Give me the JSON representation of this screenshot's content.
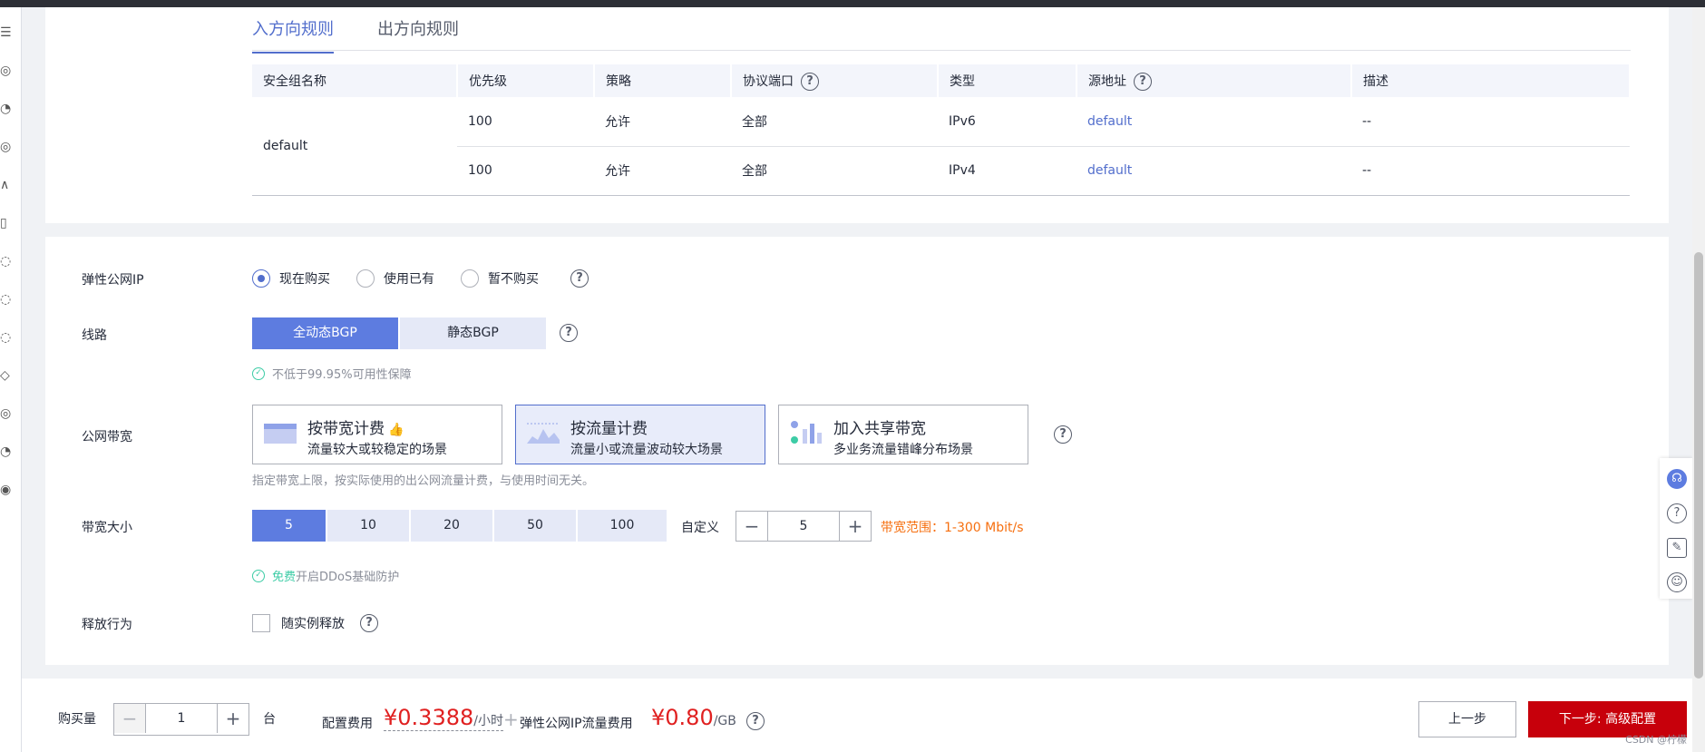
{
  "tabs": {
    "inbound": "入方向规则",
    "outbound": "出方向规则"
  },
  "rules_table": {
    "headers": [
      "安全组名称",
      "优先级",
      "策略",
      "协议端口",
      "类型",
      "源地址",
      "描述"
    ],
    "group_name": "default",
    "rows": [
      {
        "priority": "100",
        "policy": "允许",
        "port": "全部",
        "type": "IPv6",
        "source": "default",
        "desc": "--"
      },
      {
        "priority": "100",
        "policy": "允许",
        "port": "全部",
        "type": "IPv4",
        "source": "default",
        "desc": "--"
      }
    ]
  },
  "eip": {
    "label": "弹性公网IP",
    "options": [
      "现在购买",
      "使用已有",
      "暂不购买"
    ],
    "selected_index": 0
  },
  "line": {
    "label": "线路",
    "options": [
      "全动态BGP",
      "静态BGP"
    ],
    "selected_index": 0,
    "guarantee": "不低于99.95%可用性保障"
  },
  "bandwidth": {
    "label": "公网带宽",
    "cards": [
      {
        "title": "按带宽计费",
        "desc": "流量较大或较稳定的场景"
      },
      {
        "title": "按流量计费",
        "desc": "流量小或流量波动较大场景"
      },
      {
        "title": "加入共享带宽",
        "desc": "多业务流量错峰分布场景"
      }
    ],
    "selected_index": 1,
    "note": "指定带宽上限，按实际使用的出公网流量计费，与使用时间无关。"
  },
  "bw_size": {
    "label": "带宽大小",
    "options": [
      "5",
      "10",
      "20",
      "50",
      "100"
    ],
    "selected_index": 0,
    "custom_label": "自定义",
    "custom_value": "5",
    "range_text": "带宽范围：1-300 Mbit/s",
    "ddos_free": "免费",
    "ddos_text": "开启DDoS基础防护"
  },
  "release": {
    "label": "释放行为",
    "option": "随实例释放"
  },
  "footer": {
    "qty_label": "购买量",
    "qty_value": "1",
    "qty_unit": "台",
    "config_fee_label": "配置费用",
    "config_fee": "¥0.3388",
    "config_fee_unit": "/小时",
    "plus": "+",
    "eip_fee_label": "弹性公网IP流量费用",
    "eip_fee": "¥0.80",
    "eip_fee_unit": "/GB",
    "prev_button": "上一步",
    "next_button": "下一步: 高级配置"
  },
  "watermark": "CSDN @柠檬",
  "colors": {
    "accent": "#526ecc",
    "selected_fill": "#5d7ce0",
    "price": "#e02020",
    "primary_button": "#c7000b",
    "range": "#f66f0f",
    "ok": "#3dcca6"
  }
}
